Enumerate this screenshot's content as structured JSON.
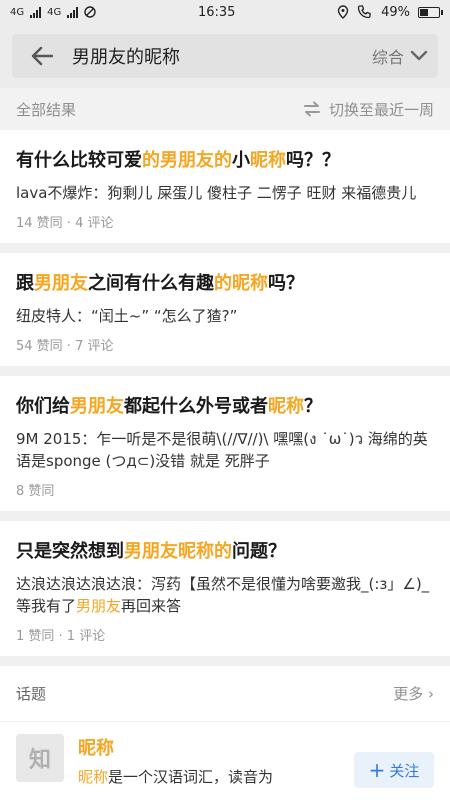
{
  "status_bar": {
    "network": "4G",
    "network2": "4G",
    "time": "16:35",
    "battery": "49%",
    "battery_level": 0.49
  },
  "header": {
    "query": "男朋友的昵称",
    "sort_label": "综合"
  },
  "meta": {
    "all_results": "全部结果",
    "switch_label": "切换至最近一周"
  },
  "results": [
    {
      "title": [
        {
          "t": "有什么比较可爱"
        },
        {
          "t": "的男朋友的",
          "hl": true
        },
        {
          "t": "小"
        },
        {
          "t": "昵称",
          "hl": true
        },
        {
          "t": "吗？？"
        }
      ],
      "excerpt": [
        {
          "t": "lava不爆炸：狗剩儿 屎蛋儿 傻柱子 二愣子 旺财 来福德贵儿"
        }
      ],
      "stats": "14 赞同 · 4 评论"
    },
    {
      "title": [
        {
          "t": "跟"
        },
        {
          "t": "男朋友",
          "hl": true
        },
        {
          "t": "之间有什么有趣"
        },
        {
          "t": "的昵称",
          "hl": true
        },
        {
          "t": "吗？"
        }
      ],
      "excerpt": [
        {
          "t": "纽皮特人：“闰土~” “怎么了猹?”"
        }
      ],
      "stats": "54 赞同 · 7 评论"
    },
    {
      "title": [
        {
          "t": "你们给"
        },
        {
          "t": "男朋友",
          "hl": true
        },
        {
          "t": "都起什么外号或者"
        },
        {
          "t": "昵称",
          "hl": true
        },
        {
          "t": "？"
        }
      ],
      "excerpt": [
        {
          "t": "9M 2015：乍一听是不是很萌\\(//∇//)\\ 嘿嘿(ง ˙ω˙)ว 海绵的英语是sponge (つд⊂)没错 就是 死胖子"
        }
      ],
      "stats": "8 赞同"
    },
    {
      "title": [
        {
          "t": "只是突然想到"
        },
        {
          "t": "男朋友昵称的",
          "hl": true
        },
        {
          "t": "问题？"
        }
      ],
      "excerpt": [
        {
          "t": "达浪达浪达浪达浪：泻药【虽然不是很懂为啥要邀我_(:з」∠)_ 等我有了"
        },
        {
          "t": "男朋友",
          "hl": true
        },
        {
          "t": "再回来答"
        }
      ],
      "stats": "1 赞同 · 1 评论"
    }
  ],
  "topics": {
    "heading": "话题",
    "more": "更多 ›",
    "item": {
      "logo_text": "知",
      "name": "昵称",
      "desc_hl": "昵称",
      "desc_rest": "是一个汉语词汇，读音为",
      "follow_label": "关注"
    }
  },
  "colors": {
    "highlight": "#f5a623",
    "link_blue": "#2f7be0"
  }
}
